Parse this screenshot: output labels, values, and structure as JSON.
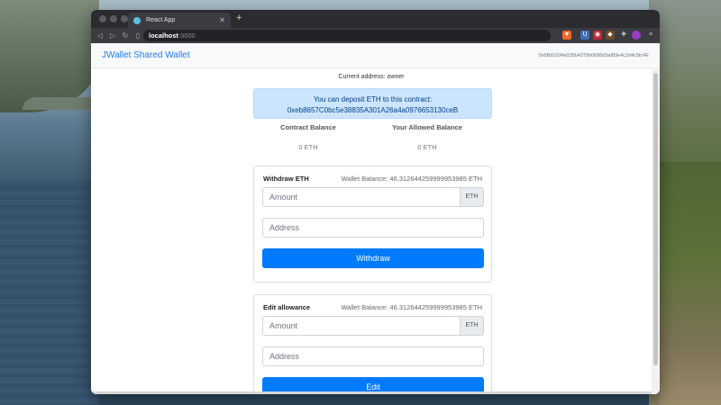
{
  "browser": {
    "tab_title": "React App",
    "url_host": "localhost",
    "url_port": ":3000"
  },
  "app": {
    "brand": "JWallet Shared Wallet",
    "nav_address": "0x6Bd1f1f4e035b4370b0686d3a8f3e4c2d4c5fc4E",
    "current_address": "Current address: owner",
    "deposit_line1": "You can deposit ETH to this contract:",
    "deposit_address": "0xeb8657C0bc5e38835A301A26a4a0976653130ceB",
    "contract_balance_label": "Contract Balance",
    "contract_balance_value": "0 ETH",
    "allowed_balance_label": "Your Allowed Balance",
    "allowed_balance_value": "0 ETH"
  },
  "withdraw": {
    "title": "Withdraw ETH",
    "wallet_balance": "Wallet Balance: 46.312644259999953985 ETH",
    "amount_placeholder": "Amount",
    "unit": "ETH",
    "address_placeholder": "Address",
    "button": "Withdraw"
  },
  "allowance": {
    "title": "Edit allowance",
    "wallet_balance": "Wallet Balance: 46.312644259999953985 ETH",
    "amount_placeholder": "Amount",
    "unit": "ETH",
    "address_placeholder": "Address",
    "button": "Edit"
  },
  "icons": [
    "back-icon",
    "forward-icon",
    "reload-icon",
    "bookmark-icon",
    "brave-shield-icon",
    "extension-icon",
    "menu-icon"
  ]
}
